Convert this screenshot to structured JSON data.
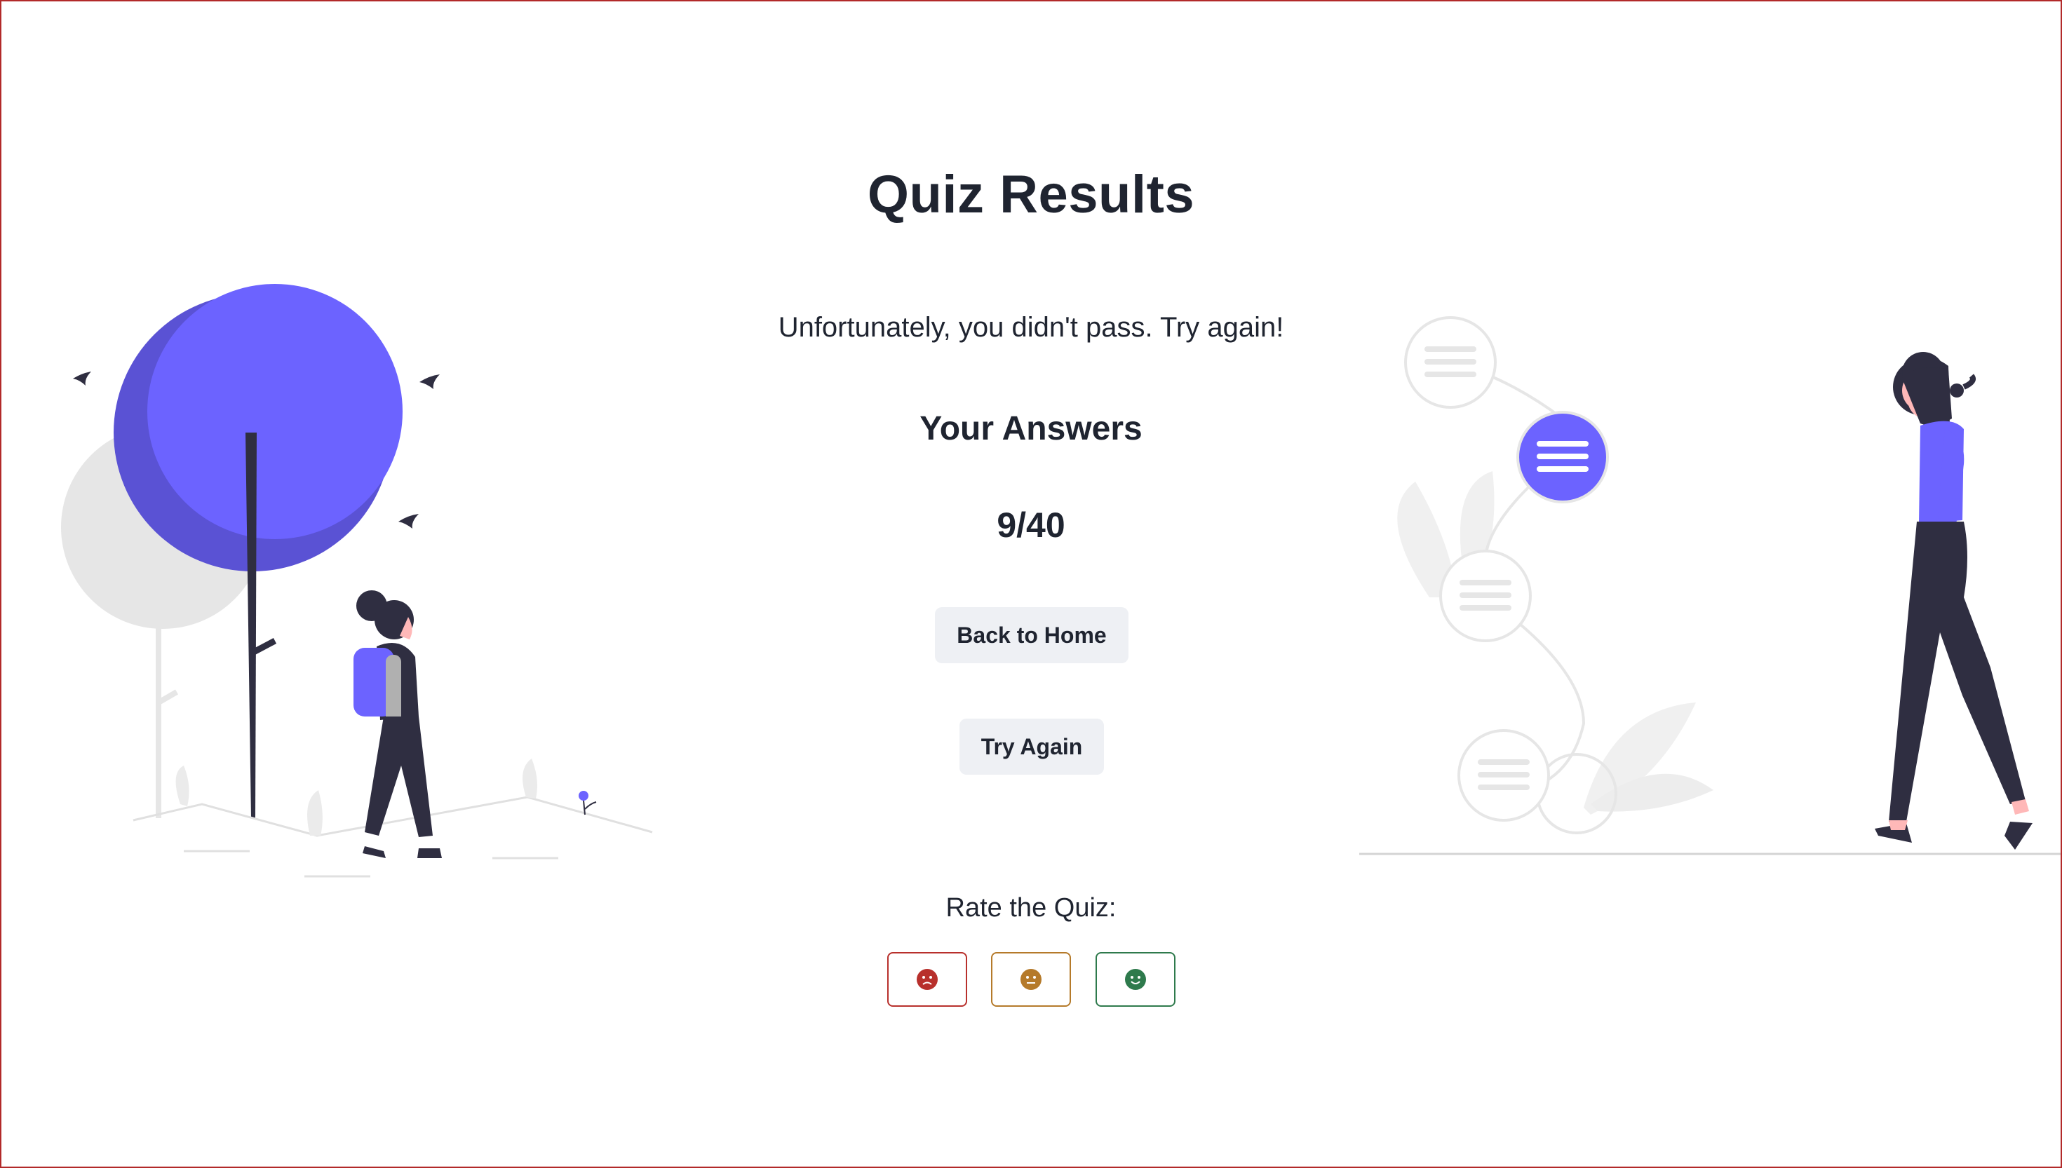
{
  "page": {
    "title": "Quiz Results",
    "message": "Unfortunately, you didn't pass. Try again!",
    "answers_heading": "Your Answers",
    "score": "9/40"
  },
  "actions": {
    "home_label": "Back to Home",
    "retry_label": "Try Again"
  },
  "rating": {
    "label": "Rate the Quiz:",
    "options": [
      {
        "icon": "sad-face-icon",
        "color": "#b8302c"
      },
      {
        "icon": "neutral-face-icon",
        "color": "#b57a2a"
      },
      {
        "icon": "happy-face-icon",
        "color": "#2e7a4c"
      }
    ]
  },
  "colors": {
    "accent": "#6c63ff",
    "text": "#1f2430",
    "button_bg": "#eef0f4",
    "frame_border": "#b22a2a"
  },
  "illustrations": {
    "left": "woman-with-backpack-under-trees-illustration",
    "right": "woman-walking-by-menu-nodes-illustration"
  }
}
